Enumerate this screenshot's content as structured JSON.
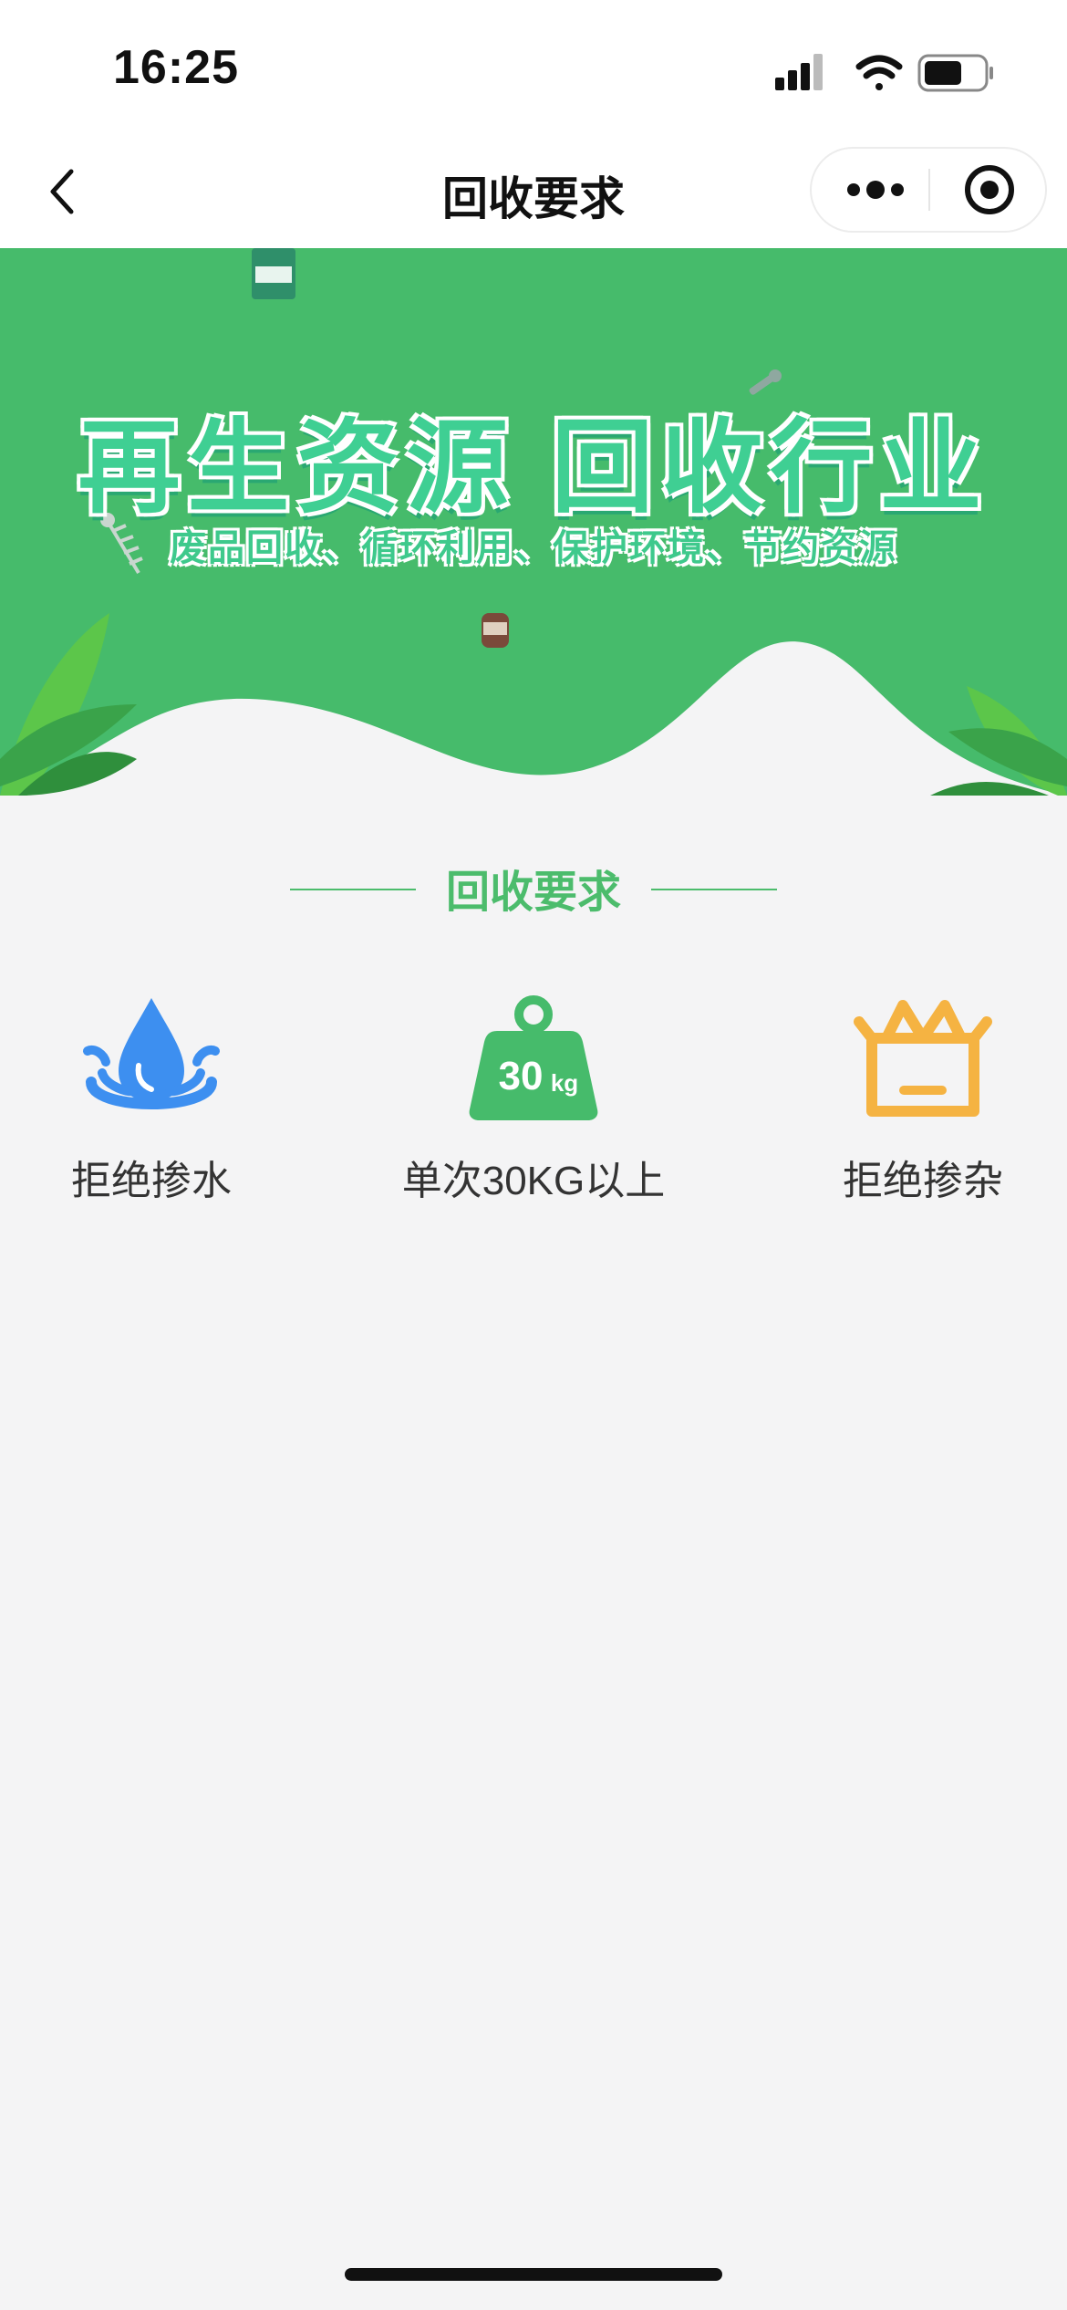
{
  "status_bar": {
    "time": "16:25"
  },
  "nav": {
    "title": "回收要求"
  },
  "banner": {
    "title": "再生资源  回收行业",
    "subtitle": "废品回收、循环利用、保护环境、节约资源",
    "colors": {
      "green": "#46bb6b",
      "wave": "#f4f4f5"
    }
  },
  "section": {
    "title": "回收要求",
    "accent": "#4cbc6c"
  },
  "requirements": [
    {
      "label": "拒绝掺水",
      "icon": "water-drop-icon",
      "color": "#3d8ff0"
    },
    {
      "label": "单次30KG以上",
      "icon": "weight-icon",
      "color": "#46bb6b",
      "weight_text": "30",
      "weight_unit": "kg"
    },
    {
      "label": "拒绝掺杂",
      "icon": "open-box-icon",
      "color": "#f5b342"
    }
  ]
}
